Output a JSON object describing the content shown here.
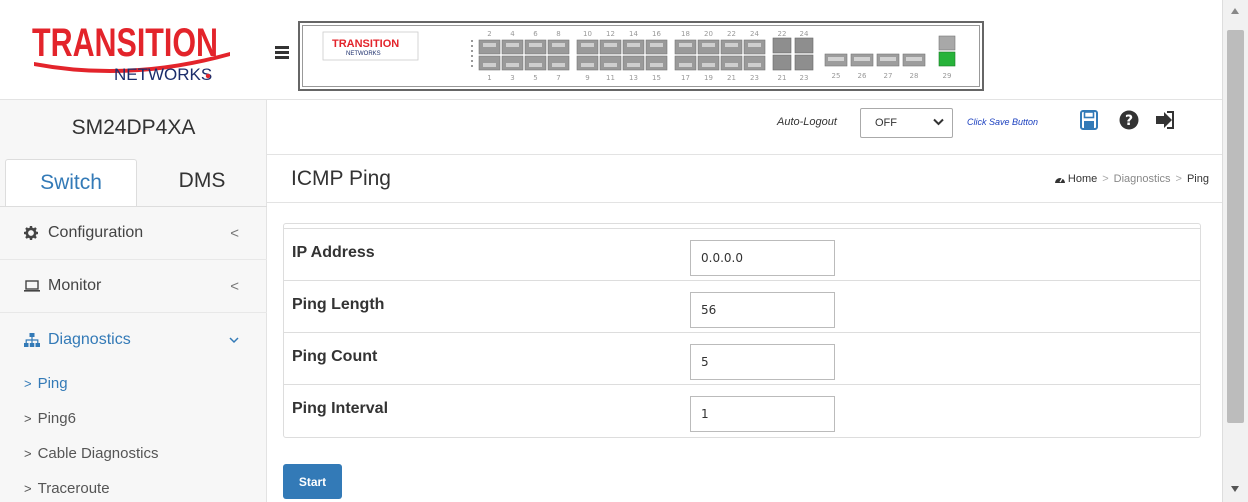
{
  "brand": {
    "logo_word1": "TRANSITION",
    "logo_word2": "NETWORKS",
    "red": "#e3242b",
    "navy": "#1b2d6b"
  },
  "sidebar": {
    "model": "SM24DP4XA",
    "tabs": [
      {
        "label": "Switch",
        "active": true
      },
      {
        "label": "DMS",
        "active": false
      }
    ],
    "menu": [
      {
        "label": "Configuration",
        "icon": "gear-icon",
        "chevron": "<",
        "open": false
      },
      {
        "label": "Monitor",
        "icon": "laptop-icon",
        "chevron": "<",
        "open": false
      },
      {
        "label": "Diagnostics",
        "icon": "sitemap-icon",
        "chevron": "v",
        "open": true
      }
    ],
    "submenu": [
      {
        "label": "Ping",
        "active": true
      },
      {
        "label": "Ping6",
        "active": false
      },
      {
        "label": "Cable Diagnostics",
        "active": false
      },
      {
        "label": "Traceroute",
        "active": false
      }
    ],
    "submenu_arrow": ">"
  },
  "device_panel": {
    "top_ports": [
      "2",
      "4",
      "6",
      "8",
      "10",
      "12",
      "14",
      "16",
      "18",
      "20",
      "22",
      "24",
      "22",
      "24"
    ],
    "bottom_ports": [
      "1",
      "3",
      "5",
      "7",
      "9",
      "11",
      "13",
      "15",
      "17",
      "19",
      "21",
      "23",
      "21",
      "23",
      "25",
      "26",
      "27",
      "28",
      "29"
    ],
    "active_port_color": "#27b33a"
  },
  "toolbar": {
    "auto_logout_label": "Auto-Logout",
    "auto_logout_value": "OFF",
    "save_hint": "Click Save Button",
    "icons": [
      "save-icon",
      "help-icon",
      "logout-icon"
    ],
    "accent": "#337ab7"
  },
  "page": {
    "title": "ICMP Ping",
    "breadcrumb": {
      "home": "Home",
      "sep": ">",
      "section": "Diagnostics",
      "current": "Ping"
    }
  },
  "form": {
    "rows": [
      {
        "label": "IP Address",
        "value": "0.0.0.0"
      },
      {
        "label": "Ping Length",
        "value": "56"
      },
      {
        "label": "Ping Count",
        "value": "5"
      },
      {
        "label": "Ping Interval",
        "value": "1"
      }
    ],
    "start_label": "Start"
  }
}
